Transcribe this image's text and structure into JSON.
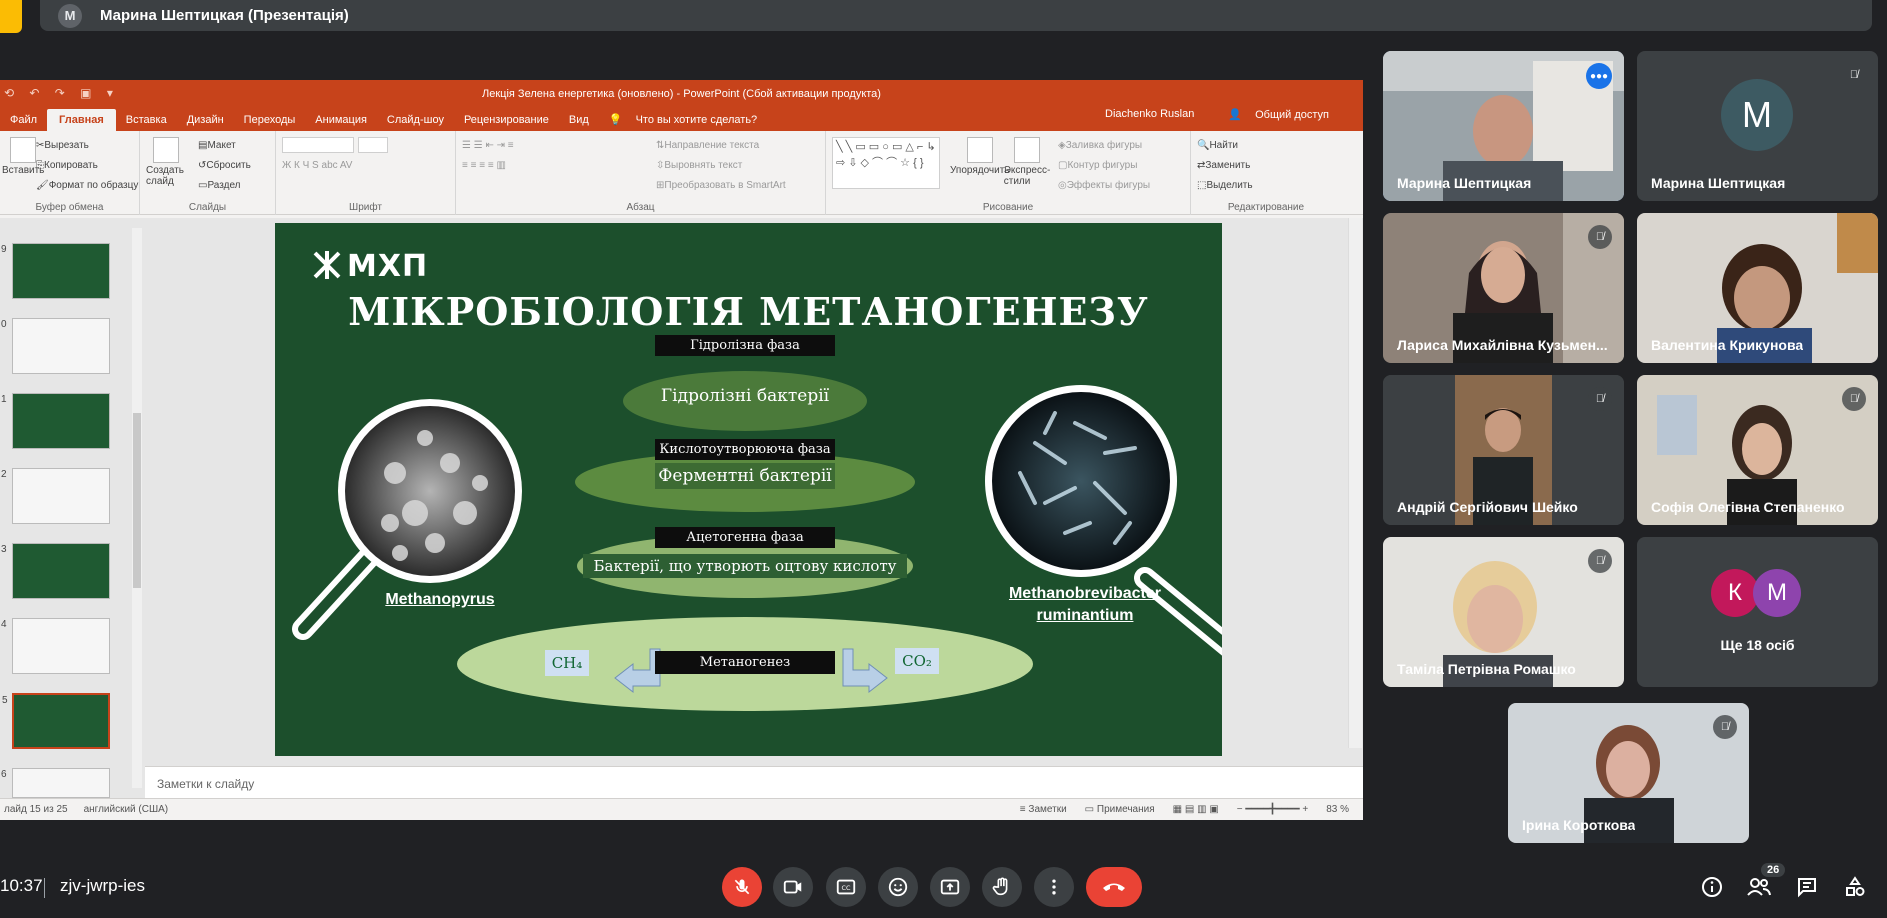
{
  "presenter_bar": {
    "avatar_letter": "М",
    "title": "Марина Шептицкая (Презентація)"
  },
  "powerpoint": {
    "window_title": "Лекція Зелена енергетика (оновлено) - PowerPoint (Сбой активации продукта)",
    "tabs": [
      "Файл",
      "Главная",
      "Вставка",
      "Дизайн",
      "Переходы",
      "Анимация",
      "Слайд-шоу",
      "Рецензирование",
      "Вид"
    ],
    "active_tab": "Главная",
    "tell_me": "Что вы хотите сделать?",
    "user": "Diachenko Ruslan",
    "share": "Общий доступ",
    "ribbon": {
      "clipboard": {
        "paste": "Вставить",
        "cut": "Вырезать",
        "copy": "Копировать",
        "format_painter": "Формат по образцу",
        "group": "Буфер обмена"
      },
      "slides": {
        "new_slide": "Создать слайд",
        "layout": "Макет",
        "reset": "Сбросить",
        "section": "Раздел",
        "group": "Слайды"
      },
      "font": {
        "group": "Шрифт",
        "buttons": "Ж К Ч S abc AV"
      },
      "paragraph": {
        "text_direction": "Направление текста",
        "align_text": "Выровнять текст",
        "smartart": "Преобразовать в SmartArt",
        "group": "Абзац"
      },
      "drawing": {
        "arrange": "Упорядочить",
        "quick_styles": "Экспресс-стили",
        "shape_fill": "Заливка фигуры",
        "shape_outline": "Контур фигуры",
        "shape_effects": "Эффекты фигуры",
        "group": "Рисование"
      },
      "editing": {
        "find": "Найти",
        "replace": "Заменить",
        "select": "Выделить",
        "group": "Редактирование"
      }
    },
    "thumb_numbers": [
      "9",
      "0",
      "1",
      "2",
      "3",
      "4",
      "5",
      "6"
    ],
    "notes_placeholder": "Заметки к слайду",
    "status": {
      "slide_info": "лайд 15 из 25",
      "language": "английский (США)",
      "notes": "Заметки",
      "comments": "Примечания",
      "zoom": "83 %"
    }
  },
  "slide": {
    "logo": "МХП",
    "title": "МІКРОБІОЛОГІЯ МЕТАНОГЕНЕЗУ",
    "phases": [
      {
        "label": "Гідролізна фаза",
        "text": "Гідролізні бактерії"
      },
      {
        "label": "Кислотоутворююча фаза",
        "text": "Ферментні бактерії"
      },
      {
        "label": "Ацетогенна фаза",
        "text": "Бактерії, що утворють оцтову кислоту"
      },
      {
        "label": "Метаногенез",
        "text": ""
      }
    ],
    "left_caption": "Methanopyrus",
    "right_caption_1": "Methanobrevibacter",
    "right_caption_2": "ruminantium",
    "ch4": "CH₄",
    "co2": "CO₂"
  },
  "participants": [
    {
      "name": "Марина Шептицкая",
      "mic": "speaking"
    },
    {
      "name": "Марина Шептицкая",
      "mic": "muted",
      "avatar_letter": "M"
    },
    {
      "name": "Лариса Михайлівна Кузьмен...",
      "mic": "muted"
    },
    {
      "name": "Валентина Крикунова",
      "mic": "none"
    },
    {
      "name": "Андрій Сергійович Шейко",
      "mic": "muted"
    },
    {
      "name": "Софія Олегівна Степаненко",
      "mic": "muted"
    },
    {
      "name": "Таміла Петрівна Ромашко",
      "mic": "muted"
    },
    {
      "name": "Ірина Короткова",
      "mic": "muted"
    }
  ],
  "others": {
    "letters": [
      "К",
      "М"
    ],
    "label": "Ще 18 осіб",
    "colors": [
      "#c2185b",
      "#8e44ad"
    ]
  },
  "bottom_bar": {
    "time": "10:37",
    "meeting_code": "zjv-jwrp-ies",
    "participant_count": "26"
  },
  "colors": {
    "accent_blue": "#8ab4f8",
    "end_red": "#ea4335",
    "ppt_orange": "#c7431b",
    "slide_green": "#1c4f2c"
  }
}
